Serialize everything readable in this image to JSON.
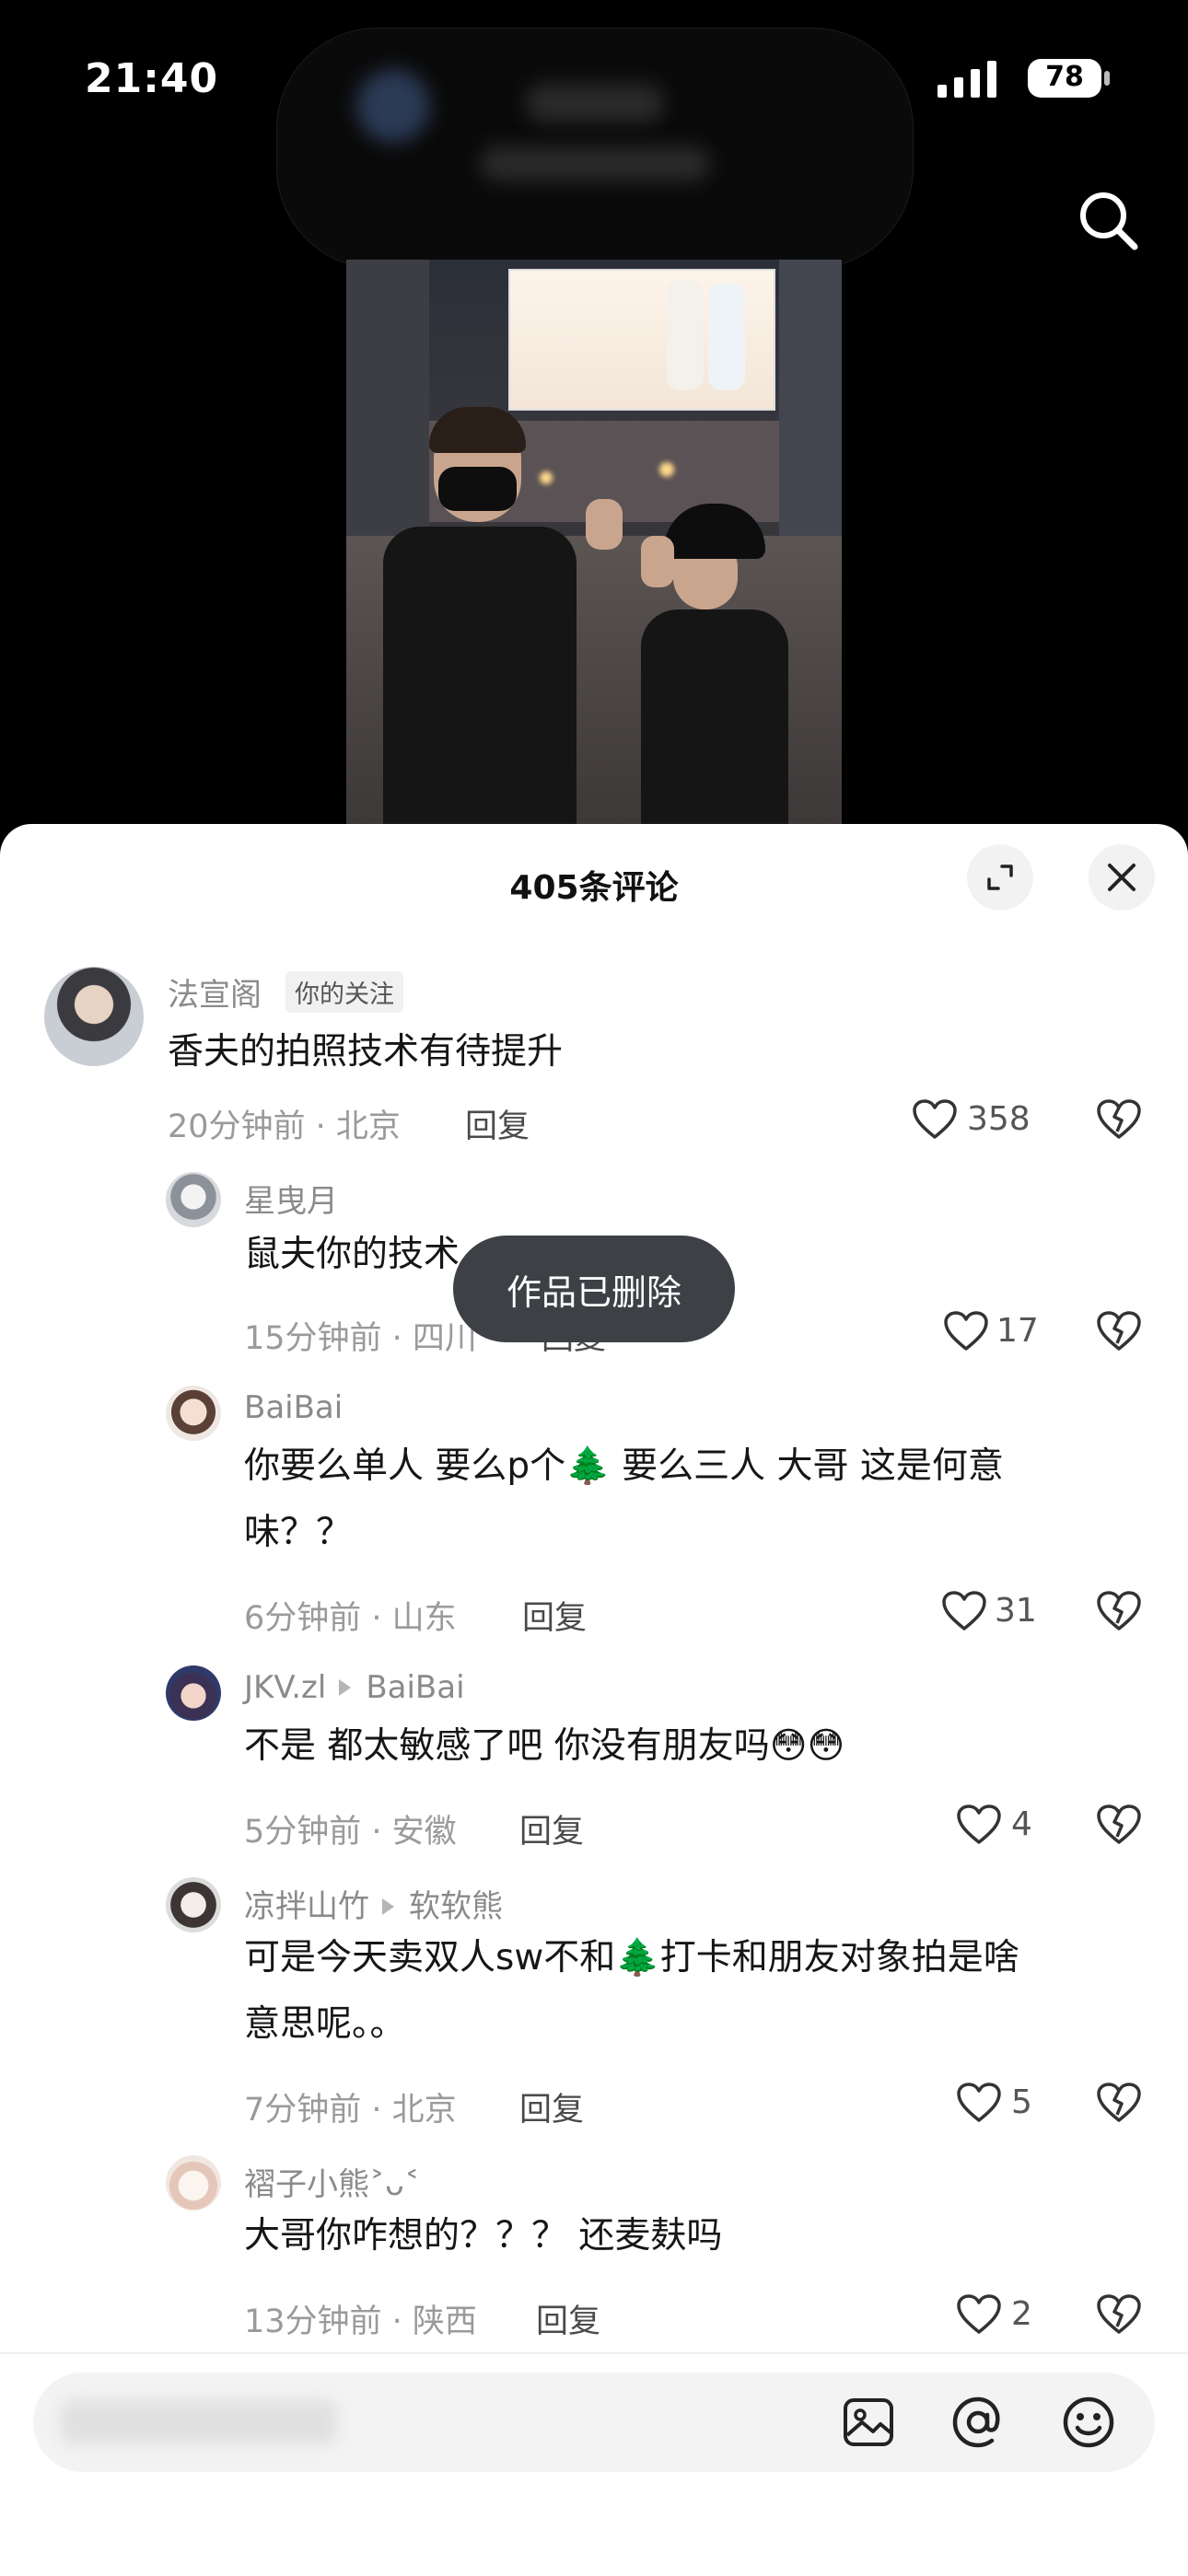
{
  "status": {
    "time": "21:40",
    "battery": "78"
  },
  "sheet": {
    "title": "405条评论"
  },
  "toast": "作品已删除",
  "comments": [
    {
      "name": "法宣阁",
      "badge": "你的关注",
      "lines": [
        "香夫的拍照技术有待提升"
      ],
      "time_location": "20分钟前 · 北京",
      "reply": "回复",
      "likes": "358"
    },
    {
      "name": "星曳月",
      "lines": [
        "鼠夫你的技术"
      ],
      "time_location": "15分钟前 · 四川",
      "reply": "回复",
      "likes": "17"
    },
    {
      "name": "BaiBai",
      "lines": [
        "你要么单人 要么p个🌲 要么三人 大哥 这是何意",
        "味？？"
      ],
      "time_location": "6分钟前 · 山东",
      "reply": "回复",
      "likes": "31"
    },
    {
      "name": "JKV.zl",
      "reply_to": "BaiBai",
      "lines": [
        "不是 都太敏感了吧 你没有朋友吗😳😳"
      ],
      "time_location": "5分钟前 · 安徽",
      "reply": "回复",
      "likes": "4"
    },
    {
      "name": "凉拌山竹",
      "reply_to": "软软熊",
      "lines": [
        "可是今天卖双人sw不和🌲打卡和朋友对象拍是啥",
        "意思呢。。"
      ],
      "time_location": "7分钟前 · 北京",
      "reply": "回复",
      "likes": "5"
    },
    {
      "name": "褶子小熊˃ᴗ˂",
      "lines": [
        "大哥你咋想的？？？ 还麦麸吗"
      ],
      "time_location": "13分钟前 · 陕西",
      "reply": "回复",
      "likes": "2"
    }
  ],
  "icons": {
    "search": "search-icon",
    "expand": "expand-icon",
    "close": "close-icon",
    "like": "heart-icon",
    "dislike": "broken-heart-icon",
    "image": "image-icon",
    "mention": "at-icon",
    "emoji": "emoji-icon"
  },
  "colors": {
    "sheet_bg": "#ffffff",
    "toast_bg": "#3d4146",
    "meta": "#9a9a9a"
  }
}
